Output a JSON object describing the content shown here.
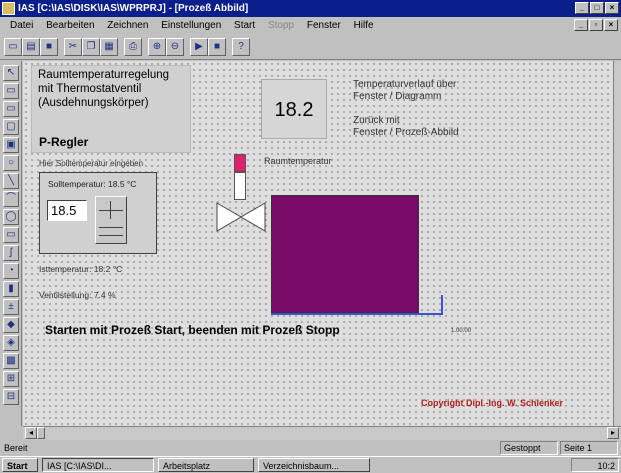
{
  "window": {
    "title": "IAS [C:\\IAS\\DISK\\IAS\\WPRPRJ] - [Prozeß Abbild]"
  },
  "menu": {
    "items": [
      "Datei",
      "Bearbeiten",
      "Zeichnen",
      "Einstellungen",
      "Start",
      "Stopp",
      "Fenster",
      "Hilfe"
    ]
  },
  "panel": {
    "title_line1": "Raumtemperaturregelung",
    "title_line2": "mit Thermostatventil",
    "title_line3": "(Ausdehnungskörper)",
    "regler": "P-Regler",
    "hint": "Hier Solltemperatur eingeben",
    "setpoint_label": "Solltemperatur: 18.5 °C",
    "setpoint_value": "18.5",
    "actual_temp": "Isttemperatur: 18.2 °C",
    "valve": "Ventilstellung: 7.4 %"
  },
  "display": {
    "value": "18.2"
  },
  "info": {
    "line1": "Temperaturverlauf über",
    "line2": "Fenster / Diagramm",
    "line3": "Zurück mit",
    "line4": "Fenster / Prozeß-Abbild"
  },
  "diagram": {
    "room_label": "Raumtemperatur",
    "tiny": "1.00.00"
  },
  "instruction": "Starten mit Prozeß Start, beenden mit Prozeß Stopp",
  "copyright": "Copyright Dipl.-Ing. W. Schlenker",
  "status": {
    "left": "Bereit",
    "mode": "Gestoppt",
    "page": "Seite 1"
  },
  "taskbar": {
    "start": "Start",
    "items": [
      "IAS [C:\\IAS\\DI...",
      "Arbeitsplatz",
      "Verzeichnisbaum..."
    ],
    "clock": "10:2"
  },
  "colors": {
    "titlebar": "#0a1e8c",
    "room": "#7a0a68",
    "indicator": "#e0206a",
    "pipe": "#4050d0",
    "copyright": "#b02020"
  }
}
